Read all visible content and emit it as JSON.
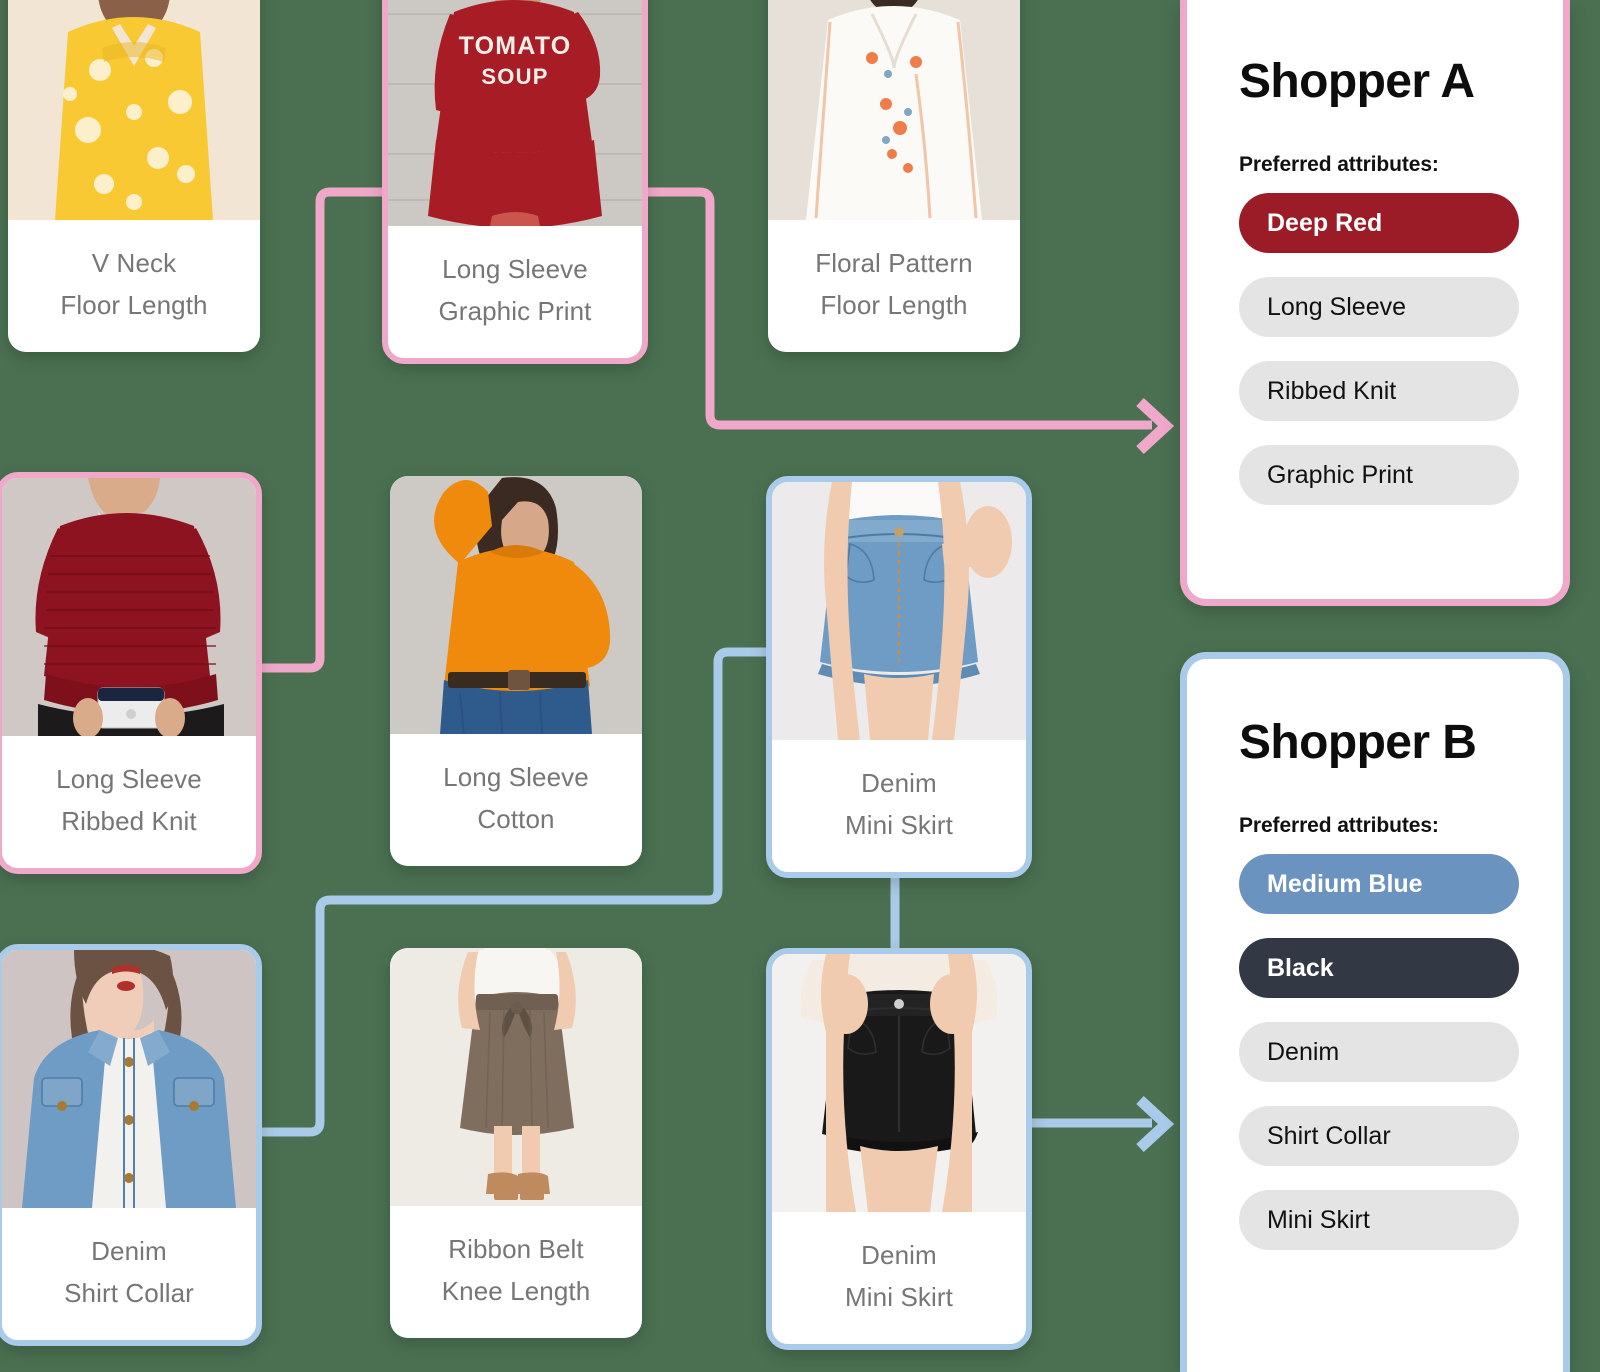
{
  "canvas": {
    "background_color": "#4a7051"
  },
  "palette": {
    "pink_accent": "#F0A8CA",
    "blue_accent": "#A9CAE8",
    "deep_red": "#9B1B27",
    "medium_blue": "#6B93BF",
    "black": "#333944",
    "neutral_pill": "#E4E4E4",
    "card_text": "#767676"
  },
  "products": [
    {
      "id": "v-neck-floor-length",
      "lines": [
        "V Neck",
        "Floor Length"
      ],
      "selected": "none",
      "image": "yellow-floral-maxi-dress"
    },
    {
      "id": "long-sleeve-graphic-print",
      "lines": [
        "Long Sleeve",
        "Graphic Print"
      ],
      "selected": "pink",
      "image": "red-tomato-soup-sweatshirt-dress"
    },
    {
      "id": "floral-pattern-floor-length",
      "lines": [
        "Floral Pattern",
        "Floor Length"
      ],
      "selected": "none",
      "image": "white-embroidered-kaftan-dress"
    },
    {
      "id": "long-sleeve-ribbed-knit",
      "lines": [
        "Long Sleeve",
        "Ribbed Knit"
      ],
      "selected": "pink",
      "image": "dark-red-ribbed-knit-sweater"
    },
    {
      "id": "long-sleeve-cotton",
      "lines": [
        "Long Sleeve",
        "Cotton"
      ],
      "selected": "none",
      "image": "orange-cotton-long-sleeve-top"
    },
    {
      "id": "denim-mini-skirt-blue",
      "lines": [
        "Denim",
        "Mini Skirt"
      ],
      "selected": "blue",
      "image": "blue-denim-mini-skirt"
    },
    {
      "id": "denim-shirt-collar",
      "lines": [
        "Denim",
        "Shirt Collar"
      ],
      "selected": "blue",
      "image": "blue-denim-jacket"
    },
    {
      "id": "ribbon-belt-knee-length",
      "lines": [
        "Ribbon Belt",
        "Knee Length"
      ],
      "selected": "none",
      "image": "brown-ribbon-belt-midi-skirt"
    },
    {
      "id": "denim-mini-skirt-black",
      "lines": [
        "Denim",
        "Mini Skirt"
      ],
      "selected": "blue",
      "image": "black-denim-mini-skirt"
    }
  ],
  "shopper_a": {
    "title": "Shopper A",
    "attributes_label": "Preferred attributes:",
    "attributes": [
      {
        "label": "Deep Red",
        "style": "accent",
        "color": "#9B1B27"
      },
      {
        "label": "Long Sleeve",
        "style": "neutral",
        "color": "#E4E4E4"
      },
      {
        "label": "Ribbed Knit",
        "style": "neutral",
        "color": "#E4E4E4"
      },
      {
        "label": "Graphic Print",
        "style": "neutral",
        "color": "#E4E4E4"
      }
    ]
  },
  "shopper_b": {
    "title": "Shopper B",
    "attributes_label": "Preferred attributes:",
    "attributes": [
      {
        "label": "Medium Blue",
        "style": "accent",
        "color": "#6B93BF"
      },
      {
        "label": "Black",
        "style": "accent",
        "color": "#333944"
      },
      {
        "label": "Denim",
        "style": "neutral",
        "color": "#E4E4E4"
      },
      {
        "label": "Shirt Collar",
        "style": "neutral",
        "color": "#E4E4E4"
      },
      {
        "label": "Mini Skirt",
        "style": "neutral",
        "color": "#E4E4E4"
      }
    ]
  }
}
